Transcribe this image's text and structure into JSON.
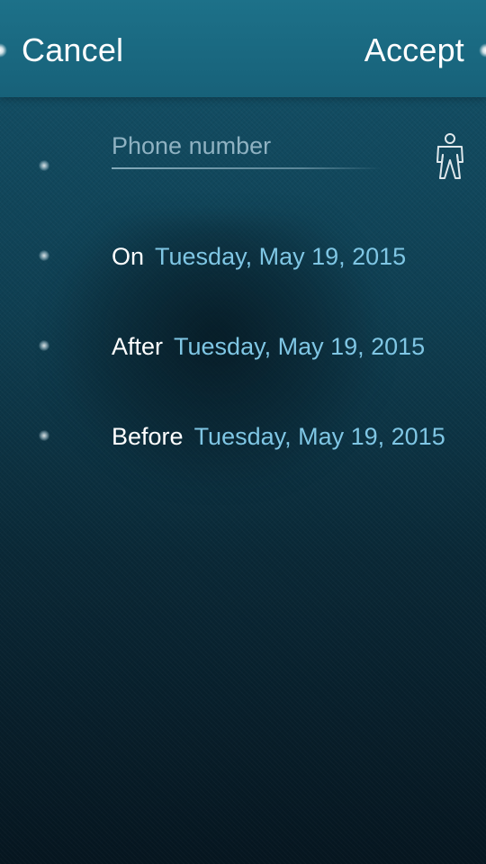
{
  "header": {
    "cancel_label": "Cancel",
    "accept_label": "Accept"
  },
  "phone": {
    "placeholder": "Phone number",
    "value": "",
    "contact_icon": "person-icon"
  },
  "date_options": [
    {
      "label": "On",
      "date": "Tuesday, May 19, 2015"
    },
    {
      "label": "After",
      "date": "Tuesday, May 19, 2015"
    },
    {
      "label": "Before",
      "date": "Tuesday, May 19, 2015"
    }
  ],
  "colors": {
    "accent": "#7fc6e4",
    "header": "#1d7189",
    "background_top": "#14536a",
    "background_bottom": "#061620"
  }
}
